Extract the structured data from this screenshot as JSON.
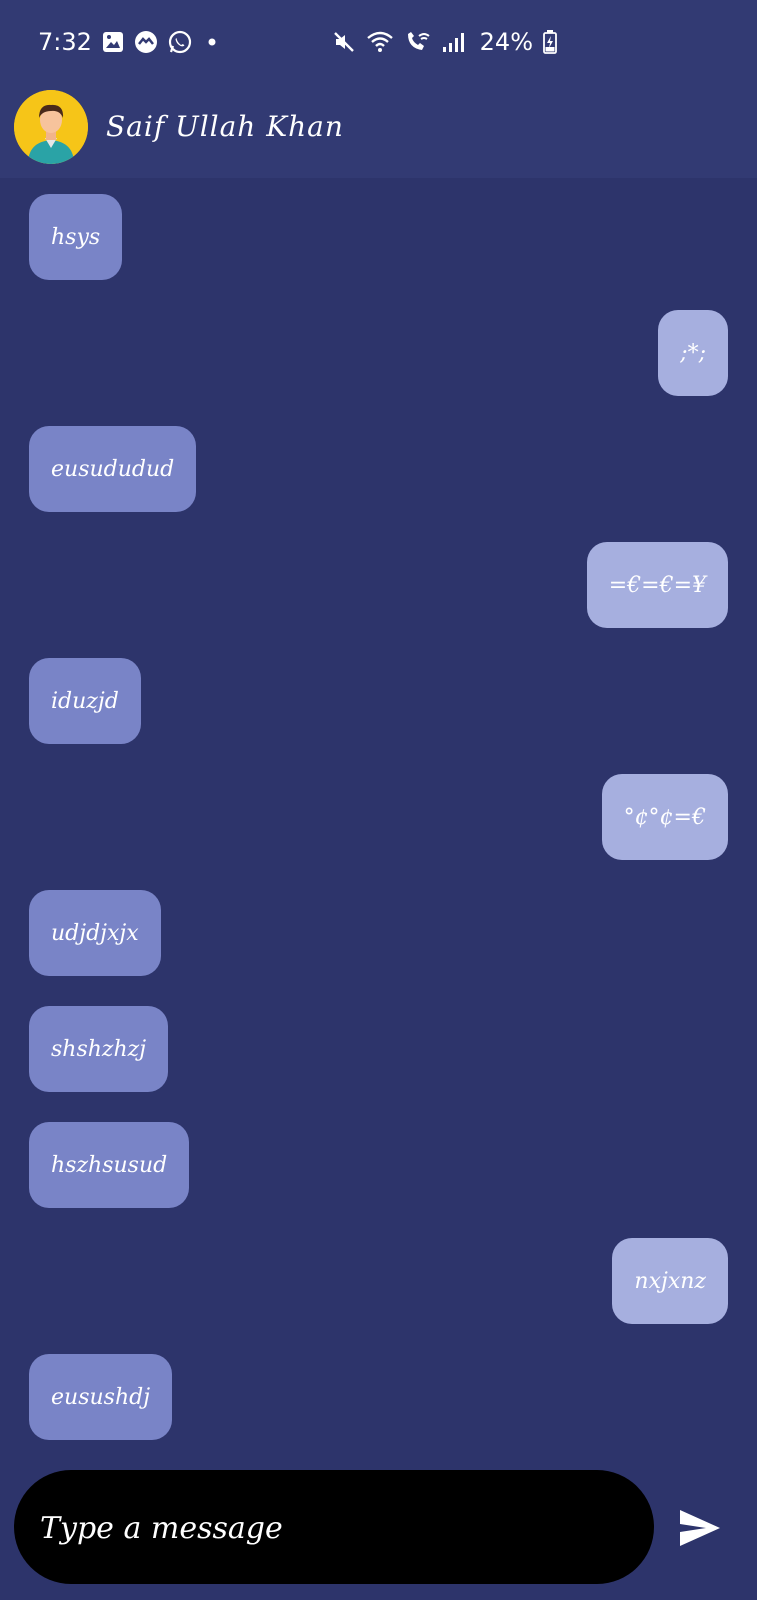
{
  "status_bar": {
    "time": "7:32",
    "battery_percent": "24%",
    "left_icons": [
      "gallery-icon",
      "messenger-icon",
      "whatsapp-icon",
      "dot-icon"
    ],
    "right_icons": [
      "mute-icon",
      "wifi-icon",
      "wifi-call-icon",
      "signal-icon",
      "battery-charging-icon"
    ]
  },
  "header": {
    "contact_name": "Saif Ullah Khan",
    "avatar_icon": "person-avatar-icon"
  },
  "messages": [
    {
      "text": "hsys",
      "direction": "incoming"
    },
    {
      "text": ";*;",
      "direction": "outgoing"
    },
    {
      "text": "eusududud",
      "direction": "incoming"
    },
    {
      "text": "=€=€=¥",
      "direction": "outgoing"
    },
    {
      "text": "iduzjd",
      "direction": "incoming"
    },
    {
      "text": "°¢°¢=€",
      "direction": "outgoing"
    },
    {
      "text": "udjdjxjx",
      "direction": "incoming"
    },
    {
      "text": "shshzhzj",
      "direction": "incoming"
    },
    {
      "text": "hszhsusud",
      "direction": "incoming"
    },
    {
      "text": "nxjxnz",
      "direction": "outgoing"
    },
    {
      "text": "eusushdj",
      "direction": "incoming"
    }
  ],
  "composer": {
    "placeholder": "Type a message",
    "value": "",
    "send_icon": "send-icon"
  },
  "colors": {
    "background": "#2d346b",
    "header": "#323a73",
    "incoming_bubble": "#7984c7",
    "outgoing_bubble": "#a6afdf",
    "input_bar": "#000000"
  }
}
